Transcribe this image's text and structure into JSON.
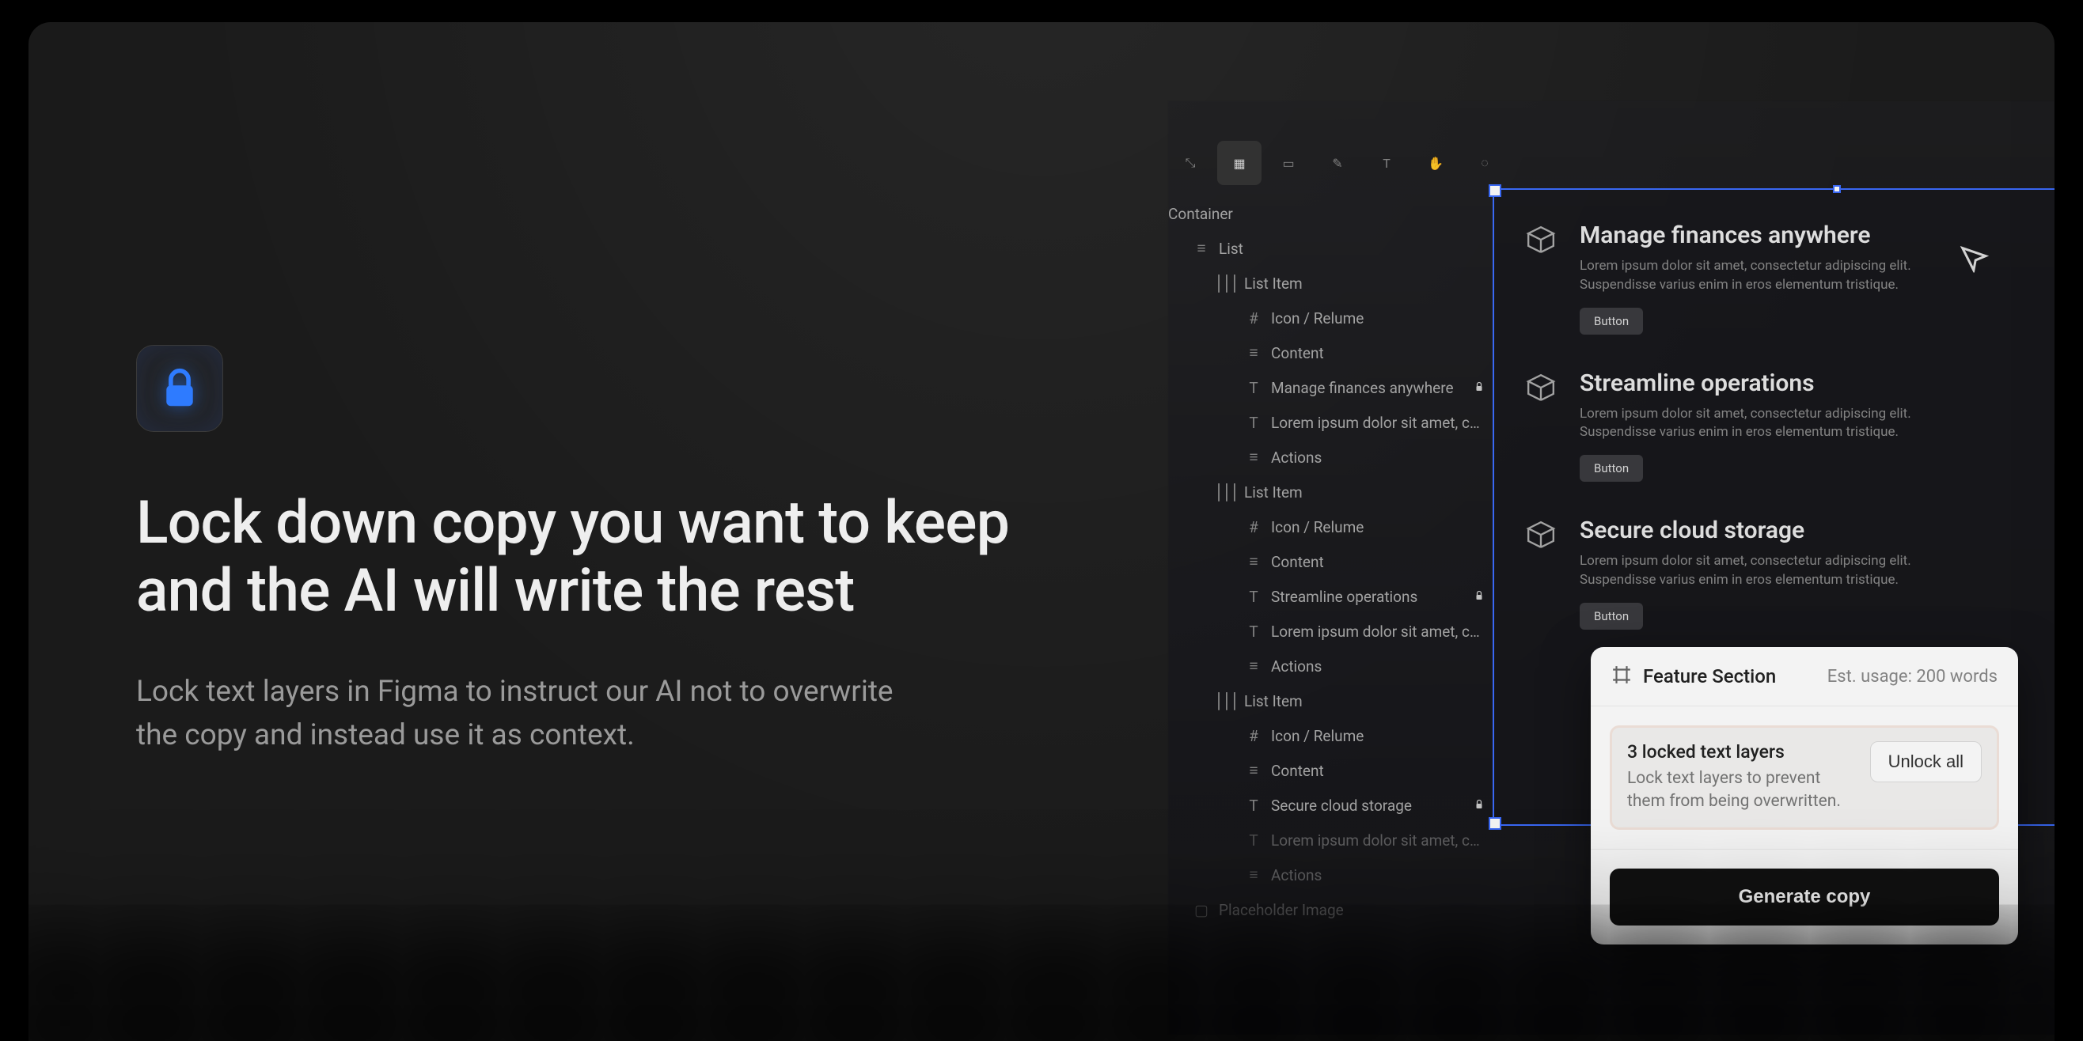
{
  "hero": {
    "headline": "Lock down copy you want to keep and the AI will write the rest",
    "subtext": "Lock text layers in Figma to instruct our AI not to overwrite the copy and instead use it as context."
  },
  "layers": {
    "root": "Container",
    "items": [
      {
        "indent": 1,
        "icon": "list",
        "label": "List"
      },
      {
        "indent": 2,
        "icon": "item",
        "label": "List Item"
      },
      {
        "indent": 3,
        "icon": "frame",
        "label": "Icon / Relume"
      },
      {
        "indent": 3,
        "icon": "list",
        "label": "Content"
      },
      {
        "indent": 3,
        "icon": "text",
        "label": "Manage finances anywhere",
        "locked": true
      },
      {
        "indent": 3,
        "icon": "text",
        "label": "Lorem ipsum dolor sit amet, conse..."
      },
      {
        "indent": 3,
        "icon": "list",
        "label": "Actions"
      },
      {
        "indent": 2,
        "icon": "item",
        "label": "List Item"
      },
      {
        "indent": 3,
        "icon": "frame",
        "label": "Icon / Relume"
      },
      {
        "indent": 3,
        "icon": "list",
        "label": "Content"
      },
      {
        "indent": 3,
        "icon": "text",
        "label": "Streamline operations",
        "locked": true
      },
      {
        "indent": 3,
        "icon": "text",
        "label": "Lorem ipsum dolor sit amet, conse..."
      },
      {
        "indent": 3,
        "icon": "list",
        "label": "Actions"
      },
      {
        "indent": 2,
        "icon": "item",
        "label": "List Item"
      },
      {
        "indent": 3,
        "icon": "frame",
        "label": "Icon / Relume"
      },
      {
        "indent": 3,
        "icon": "list",
        "label": "Content"
      },
      {
        "indent": 3,
        "icon": "text",
        "label": "Secure cloud storage",
        "locked": true
      },
      {
        "indent": 3,
        "icon": "text",
        "label": "Lorem ipsum dolor sit amet, conse...",
        "dim": true
      },
      {
        "indent": 3,
        "icon": "list",
        "label": "Actions",
        "dim": true
      },
      {
        "indent": 1,
        "icon": "image",
        "label": "Placeholder Image",
        "dim": true
      }
    ]
  },
  "cards": [
    {
      "title": "Manage finances anywhere",
      "desc": "Lorem ipsum dolor sit amet, consectetur adipiscing elit. Suspendisse varius enim in eros elementum tristique.",
      "button": "Button"
    },
    {
      "title": "Streamline operations",
      "desc": "Lorem ipsum dolor sit amet, consectetur adipiscing elit. Suspendisse varius enim in eros elementum tristique.",
      "button": "Button"
    },
    {
      "title": "Secure cloud storage",
      "desc": "Lorem ipsum dolor sit amet, consectetur adipiscing elit. Suspendisse varius enim in eros elementum tristique.",
      "button": "Button"
    }
  ],
  "popover": {
    "title": "Feature Section",
    "estimate": "Est. usage: 200 words",
    "notice_title": "3 locked text layers",
    "notice_desc": "Lock text layers to prevent them from being overwritten.",
    "unlock": "Unlock all",
    "generate": "Generate copy"
  }
}
